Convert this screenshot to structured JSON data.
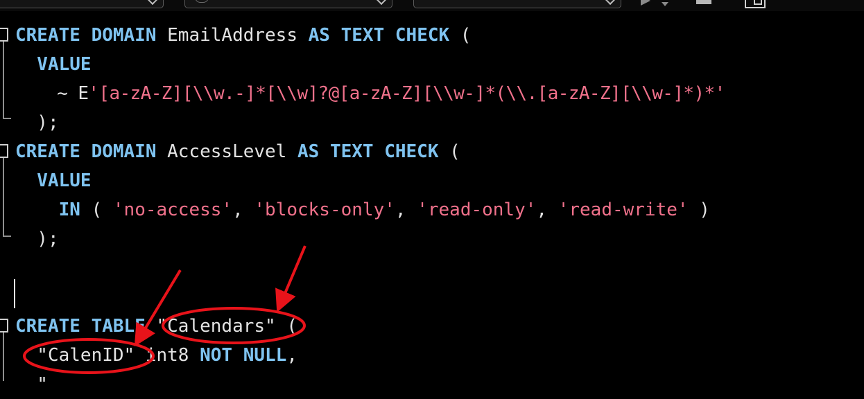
{
  "toolbar": {
    "combos": [
      "connection-combo",
      "database-combo",
      "schema-combo"
    ],
    "icons": [
      "run-icon",
      "dropdown-caret-icon",
      "stop-icon",
      "panel-toggle-icon"
    ]
  },
  "code": {
    "l1": {
      "a": "CREATE DOMAIN",
      "b": " EmailAddress ",
      "c": "AS TEXT CHECK",
      "d": " ("
    },
    "l2": {
      "a": "  VALUE"
    },
    "l3": {
      "a": "    ~ E",
      "b": "'[a-zA-Z][\\\\w.-]*[\\\\w]?@[a-zA-Z][\\\\w-]*(\\\\.[a-zA-Z][\\\\w-]*)*'"
    },
    "l4": {
      "a": "  );"
    },
    "l5": {
      "a": "CREATE DOMAIN",
      "b": " AccessLevel ",
      "c": "AS TEXT CHECK",
      "d": " ("
    },
    "l6": {
      "a": "  VALUE"
    },
    "l7": {
      "a": "    IN",
      "b": " ( ",
      "c": "'no-access'",
      "d": ", ",
      "e": "'blocks-only'",
      "f": ", ",
      "g": "'read-only'",
      "h": ", ",
      "i": "'read-write'",
      "j": " )"
    },
    "l8": {
      "a": "  );"
    },
    "l9": {
      "a": "CREATE TABLE",
      "b": " \"Calendars\" ("
    },
    "l10": {
      "a": "  \"CalenID\" int8 ",
      "b": "NOT NULL",
      "c": ","
    }
  },
  "colors": {
    "keyword": "#7fc3f0",
    "string": "#f0718b",
    "plain": "#e3e3e3",
    "background": "#000000",
    "annotation": "#e8131a"
  }
}
